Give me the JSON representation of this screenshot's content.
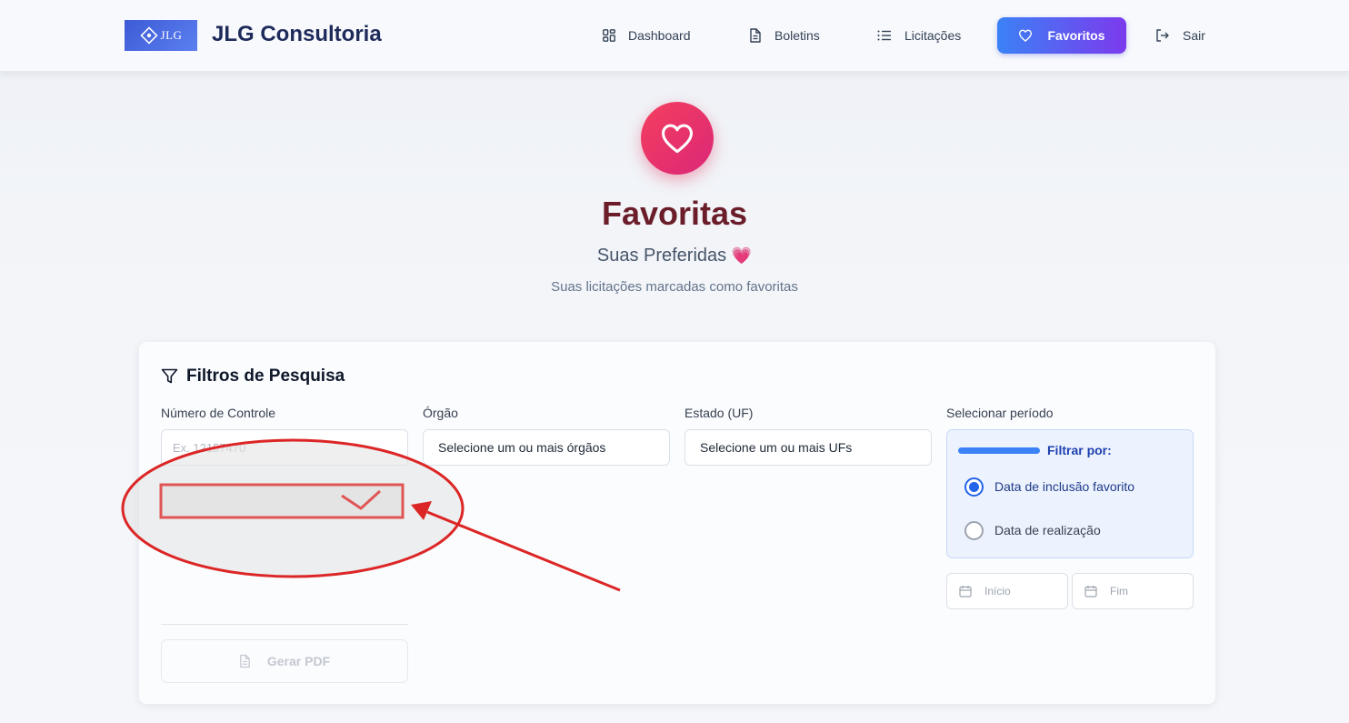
{
  "header": {
    "logo_text": "JLG",
    "brand": "JLG Consultoria",
    "nav": [
      {
        "label": "Dashboard",
        "icon": "grid-icon"
      },
      {
        "label": "Boletins",
        "icon": "document-icon"
      },
      {
        "label": "Licitações",
        "icon": "list-icon"
      },
      {
        "label": "Favoritos",
        "icon": "heart-icon",
        "active": true
      },
      {
        "label": "Sair",
        "icon": "logout-icon"
      }
    ]
  },
  "hero": {
    "icon": "heart-icon",
    "title": "Favoritas",
    "subtitle": "Suas Preferidas",
    "subtitle_emoji": "💗",
    "description": "Suas licitações marcadas como favoritas"
  },
  "filters": {
    "title": "Filtros de Pesquisa",
    "numero_controle": {
      "label": "Número de Controle",
      "placeholder": "Ex. 12157470"
    },
    "orgao": {
      "label": "Órgão",
      "value": "Selecione um ou mais órgãos"
    },
    "estado": {
      "label": "Estado (UF)",
      "value": "Selecione um ou mais UFs"
    },
    "periodo": {
      "label": "Selecionar período",
      "filter_label": "Filtrar por:",
      "options": [
        {
          "label": "Data de inclusão favorito",
          "checked": true
        },
        {
          "label": "Data de realização",
          "checked": false
        }
      ],
      "start_placeholder": "Início",
      "end_placeholder": "Fim"
    },
    "pdf_button": "Gerar PDF"
  },
  "colors": {
    "accent_gradient_start": "#3b82f6",
    "accent_gradient_end": "#7c3aed",
    "hero_red": "#f43f5e",
    "title_color": "#6b1d2a",
    "annotation_red": "#dc2626"
  }
}
